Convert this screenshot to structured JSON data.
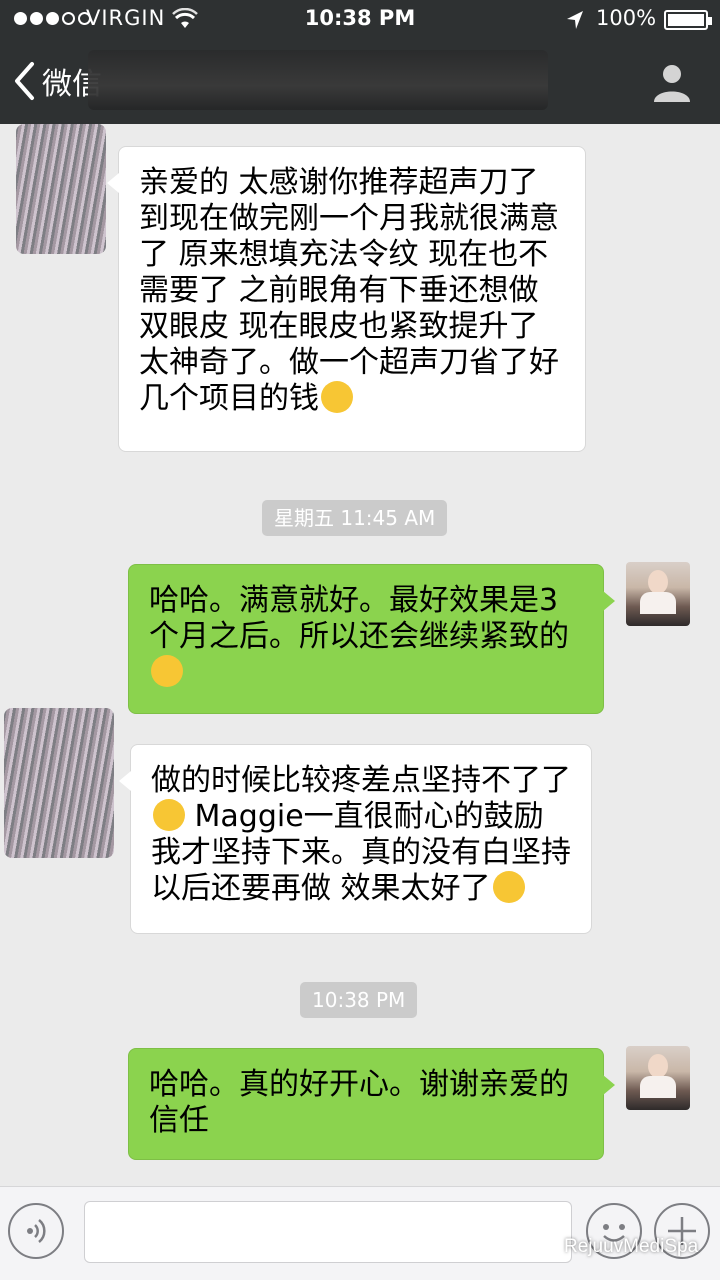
{
  "status_bar": {
    "carrier": "VIRGIN",
    "time": "10:38 PM",
    "battery": "100%",
    "signal_dots": 5,
    "signal_filled": 3
  },
  "nav": {
    "back_label": "微信",
    "back_label_shown": "微信"
  },
  "messages": [
    {
      "side": "incoming",
      "text": "亲爱的  太感谢你推荐超声刀了 到现在做完刚一个月我就很满意了 原来想填充法令纹 现在也不需要了  之前眼角有下垂还想做双眼皮 现在眼皮也紧致提升了 太神奇了。做一个超声刀省了好几个项目的钱",
      "emoji": "thinking-face"
    },
    {
      "type": "timestamp",
      "text": "星期五 11:45 AM"
    },
    {
      "side": "outgoing",
      "text": "哈哈。满意就好。最好效果是3个月之后。所以还会继续紧致的",
      "emoji": "sunglasses-face"
    },
    {
      "side": "incoming",
      "text_before": "做的时候比较疼差点坚持不了了",
      "emoji_inline": "crying-laughing-face",
      "text_after": " Maggie一直很耐心的鼓励我才坚持下来。真的没有白坚持 以后还要再做 效果太好了",
      "emoji": "hugging-face"
    },
    {
      "type": "timestamp",
      "text": "10:38 PM"
    },
    {
      "side": "outgoing",
      "text": "哈哈。真的好开心。谢谢亲爱的信任"
    }
  ],
  "input": {
    "value": "",
    "placeholder": ""
  },
  "watermark": "RejuuvMediSpa",
  "colors": {
    "header": "#2e3132",
    "chat_bg": "#ebebeb",
    "outgoing_bubble": "#8bd34e",
    "incoming_bubble": "#ffffff"
  }
}
